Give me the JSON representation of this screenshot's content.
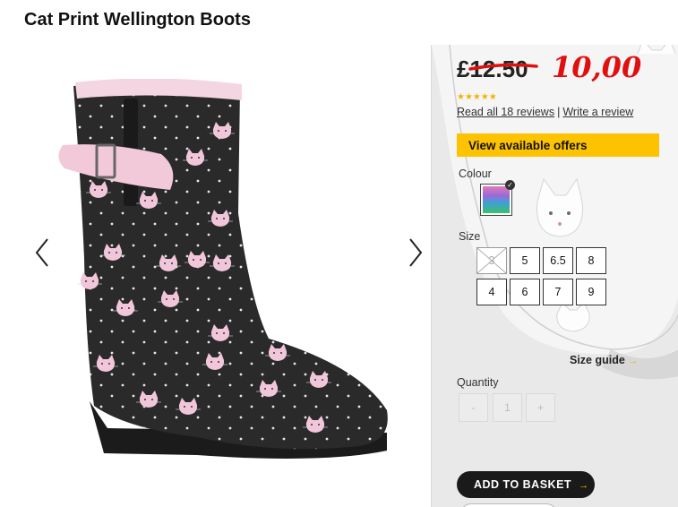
{
  "product": {
    "title": "Cat Print Wellington Boots"
  },
  "gallery": {
    "prev_icon": "chevron-left-icon",
    "next_icon": "chevron-right-icon"
  },
  "price": {
    "old": "£12.50",
    "new": "10,00",
    "new_color": "#e01010"
  },
  "rating": {
    "stars": "★★★★★",
    "star_color": "#f1b400"
  },
  "reviews": {
    "read_all": "Read all 18 reviews",
    "separator": "|",
    "write": "Write a review"
  },
  "offers": {
    "label": "View available offers",
    "color": "#fdc300"
  },
  "colour": {
    "label": "Colour"
  },
  "size": {
    "label": "Size",
    "options": [
      "3",
      "5",
      "6.5",
      "8",
      "4",
      "6",
      "7",
      "9"
    ],
    "unavailable": [
      "3"
    ],
    "guide": "Size guide",
    "guide_arrow": "→"
  },
  "quantity": {
    "label": "Quantity",
    "minus": "-",
    "value": "1",
    "plus": "+"
  },
  "basket": {
    "label": "ADD TO BASKET",
    "arrow": "→"
  }
}
